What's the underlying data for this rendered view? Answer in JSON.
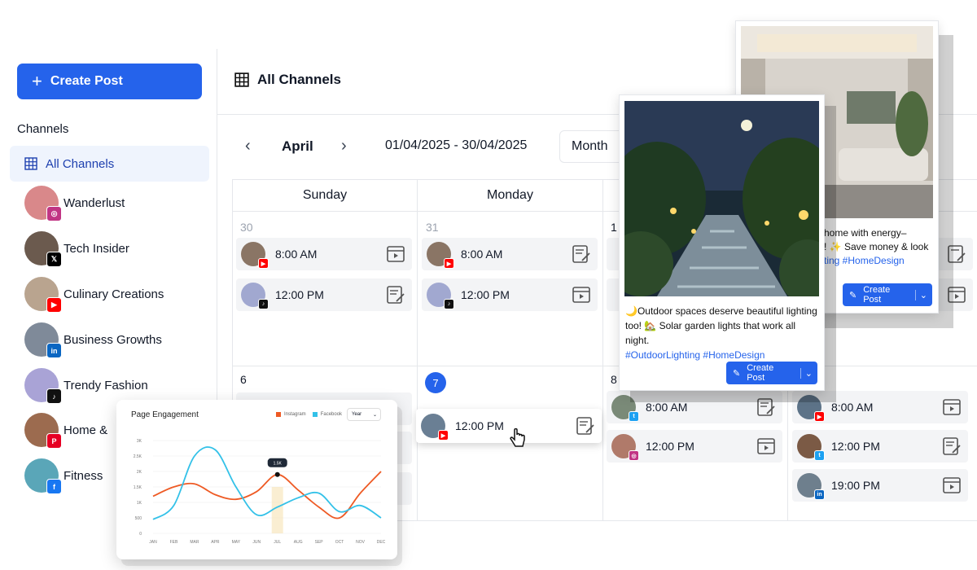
{
  "sidebar": {
    "create_post": "Create Post",
    "channels_label": "Channels",
    "all_channels": "All Channels",
    "channels": [
      {
        "name": "Wanderlust",
        "platform": "instagram",
        "color": "#c13584",
        "avatar": "#d9888a"
      },
      {
        "name": "Tech Insider",
        "platform": "x",
        "color": "#000000",
        "avatar": "#6b5a4e"
      },
      {
        "name": "Culinary Creations",
        "platform": "youtube",
        "color": "#ff0000",
        "avatar": "#b9a48f"
      },
      {
        "name": "Business Growths",
        "platform": "linkedin",
        "color": "#0a66c2",
        "avatar": "#7f8a99"
      },
      {
        "name": "Trendy Fashion",
        "platform": "tiktok",
        "color": "#111111",
        "avatar": "#a9a3d6"
      },
      {
        "name": "Home &",
        "platform": "pinterest",
        "color": "#e60023",
        "avatar": "#9c6b4f"
      },
      {
        "name": "Fitness",
        "platform": "facebook",
        "color": "#1877f2",
        "avatar": "#5aa6b8"
      }
    ]
  },
  "header": {
    "title": "All Channels"
  },
  "calendar": {
    "month": "April",
    "range": "01/04/2025 - 30/04/2025",
    "view": "Month",
    "days": [
      "Sunday",
      "Monday"
    ],
    "cells": {
      "c30": "30",
      "c31": "31",
      "c1": "1",
      "c6": "6",
      "c7": "7",
      "c8": "8"
    },
    "events": {
      "sun1": {
        "time": "8:00 AM"
      },
      "sun2": {
        "time": "12:00 PM"
      },
      "mon1": {
        "time": "8:00 AM"
      },
      "mon2": {
        "time": "12:00 PM"
      },
      "mon7": {
        "time": "12:00 PM"
      },
      "wed1": {
        "time": "8:00 AM"
      },
      "wed2": {
        "time": "12:00 PM"
      },
      "thu1": {
        "time": "8:00 AM"
      },
      "thu2": {
        "time": "12:00 PM"
      },
      "thu3": {
        "time": "19:00 PM"
      }
    }
  },
  "popup_main": {
    "caption_1": "🌙Outdoor spaces deserve beautiful lighting too! 🏡 Solar garden lights that work all night.",
    "tags": "#OutdoorLighting #HomeDesign",
    "button": "Create Post"
  },
  "popup_back": {
    "line1": "home with energy–",
    "line2": "! ✨ Save money & look",
    "tags": "ting #HomeDesign",
    "button": "Create Post"
  },
  "engagement": {
    "title": "Page Engagement",
    "legend_instagram": "Instagram",
    "legend_facebook": "Facebook",
    "period": "Year",
    "tooltip": "1.5K"
  },
  "chart_data": {
    "type": "line",
    "title": "Page Engagement",
    "categories": [
      "JAN",
      "FEB",
      "MAR",
      "APR",
      "MAY",
      "JUN",
      "JUL",
      "AUG",
      "SEP",
      "OCT",
      "NOV",
      "DEC"
    ],
    "y_ticks": [
      "0",
      "500",
      "1K",
      "1.5K",
      "2K",
      "2.5K",
      "3K"
    ],
    "ylim": [
      0,
      3000
    ],
    "series": [
      {
        "name": "Instagram",
        "color": "#ee5a24",
        "values": [
          1200,
          1500,
          1600,
          1250,
          1100,
          1350,
          1900,
          1400,
          850,
          500,
          1300,
          2000
        ]
      },
      {
        "name": "Facebook",
        "color": "#33c1e8",
        "values": [
          450,
          900,
          2500,
          2700,
          1500,
          600,
          850,
          1150,
          1300,
          700,
          900,
          500
        ]
      }
    ],
    "legend": "top-right",
    "grid": true
  }
}
